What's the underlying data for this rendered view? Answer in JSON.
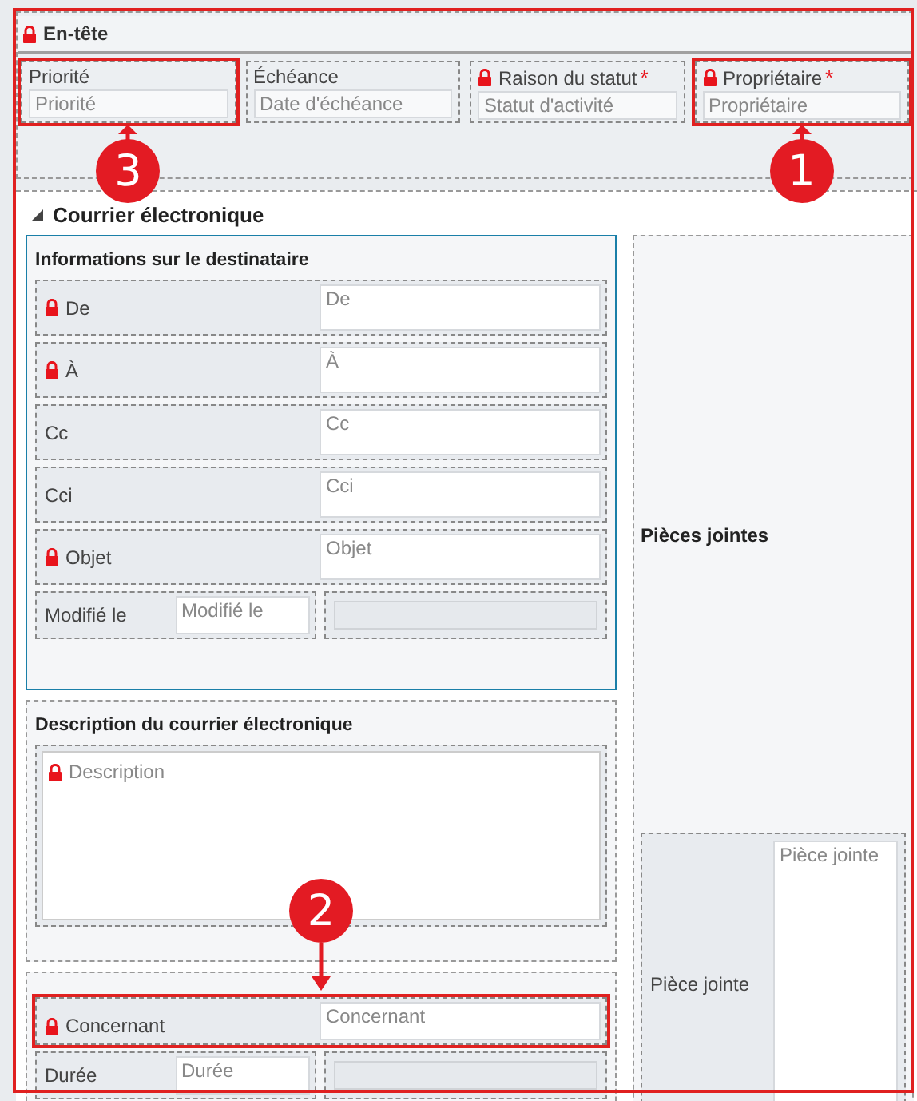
{
  "header": {
    "title": "En-tête",
    "locked": true,
    "fields": [
      {
        "label": "Priorité",
        "placeholder": "Priorité",
        "locked": false,
        "required": false,
        "callout": "3"
      },
      {
        "label": "Échéance",
        "placeholder": "Date d'échéance",
        "locked": false,
        "required": false
      },
      {
        "label": "Raison du statut",
        "required": true,
        "required_mark": "*",
        "placeholder": "Statut d'activité",
        "locked": true
      },
      {
        "label": "Propriétaire",
        "required": true,
        "required_mark": "*",
        "placeholder": "Propriétaire",
        "locked": true,
        "callout": "1"
      }
    ]
  },
  "tab": {
    "title": "Courrier électronique",
    "expanded": true,
    "sections": [
      {
        "title": "Informations sur le destinataire",
        "selected": true,
        "fields": [
          {
            "kind": "row",
            "label": "De",
            "placeholder": "De",
            "locked": true
          },
          {
            "kind": "row",
            "label": "À",
            "placeholder": "À",
            "locked": true
          },
          {
            "kind": "row",
            "label": "Cc",
            "placeholder": "Cc",
            "locked": false
          },
          {
            "kind": "row",
            "label": "Cci",
            "placeholder": "Cci",
            "locked": false
          },
          {
            "kind": "row",
            "label": "Objet",
            "placeholder": "Objet",
            "locked": true
          },
          {
            "kind": "short",
            "label": "Modifié le",
            "placeholder": "Modifié le",
            "locked": false
          }
        ]
      },
      {
        "title": "Description du courrier électronique",
        "selected": false,
        "fields": [
          {
            "kind": "textarea",
            "placeholder": "Description",
            "locked": true
          }
        ]
      },
      {
        "selected": false,
        "fields": [
          {
            "kind": "row",
            "label": "Concernant",
            "placeholder": "Concernant",
            "locked": true,
            "callout": "2"
          },
          {
            "kind": "short",
            "label": "Durée",
            "placeholder": "Durée",
            "locked": false
          }
        ]
      }
    ],
    "side": {
      "title": "Pièces jointes",
      "fields": [
        {
          "label": "Pièce jointe",
          "placeholder": "Pièce jointe"
        }
      ]
    }
  },
  "frame_highlighted": true
}
